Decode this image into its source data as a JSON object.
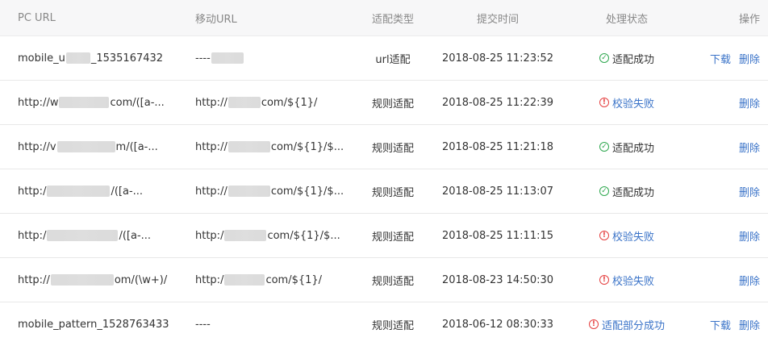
{
  "header": {
    "pc_url": "PC URL",
    "mobile_url": "移动URL",
    "type": "适配类型",
    "time": "提交时间",
    "status": "处理状态",
    "ops": "操作"
  },
  "rows": [
    {
      "pc_pre": "mobile_u",
      "pc_post": "_1535167432",
      "mobile_pre": "----",
      "mobile_post": "",
      "type": "url适配",
      "time": "2018-08-25 11:23:52",
      "status": "适配成功",
      "status_kind": "success",
      "status_icon": "check-circle-icon",
      "download": "下载",
      "delete": "删除"
    },
    {
      "pc_pre": "http://w",
      "pc_post": "com/([a-...",
      "mobile_pre": "http://",
      "mobile_post": "com/${1}/",
      "type": "规则适配",
      "time": "2018-08-25 11:22:39",
      "status": "校验失败",
      "status_kind": "error",
      "status_icon": "alert-circle-icon",
      "download": "",
      "delete": "删除"
    },
    {
      "pc_pre": "http://v",
      "pc_post": "m/([a-...",
      "mobile_pre": "http://",
      "mobile_post": "com/${1}/$...",
      "type": "规则适配",
      "time": "2018-08-25 11:21:18",
      "status": "适配成功",
      "status_kind": "success",
      "status_icon": "check-circle-icon",
      "download": "",
      "delete": "删除"
    },
    {
      "pc_pre": "http:/",
      "pc_post": "/([a-...",
      "mobile_pre": "http://",
      "mobile_post": "com/${1}/$...",
      "type": "规则适配",
      "time": "2018-08-25 11:13:07",
      "status": "适配成功",
      "status_kind": "success",
      "status_icon": "check-circle-icon",
      "download": "",
      "delete": "删除"
    },
    {
      "pc_pre": "http:/",
      "pc_post": "/([a-...",
      "mobile_pre": "http:/",
      "mobile_post": "com/${1}/$...",
      "type": "规则适配",
      "time": "2018-08-25 11:11:15",
      "status": "校验失败",
      "status_kind": "error",
      "status_icon": "alert-circle-icon",
      "download": "",
      "delete": "删除"
    },
    {
      "pc_pre": "http://",
      "pc_post": "om/(\\w+)/",
      "mobile_pre": "http:/",
      "mobile_post": "com/${1}/",
      "type": "规则适配",
      "time": "2018-08-23 14:50:30",
      "status": "校验失败",
      "status_kind": "error",
      "status_icon": "alert-circle-icon",
      "download": "",
      "delete": "删除"
    },
    {
      "pc_pre": "mobile_pattern_1528763433",
      "pc_post": "",
      "mobile_pre": "----",
      "mobile_post": "",
      "type": "规则适配",
      "time": "2018-06-12 08:30:33",
      "status": "适配部分成功",
      "status_kind": "error",
      "status_icon": "alert-circle-icon",
      "download": "下载",
      "delete": "删除"
    }
  ]
}
